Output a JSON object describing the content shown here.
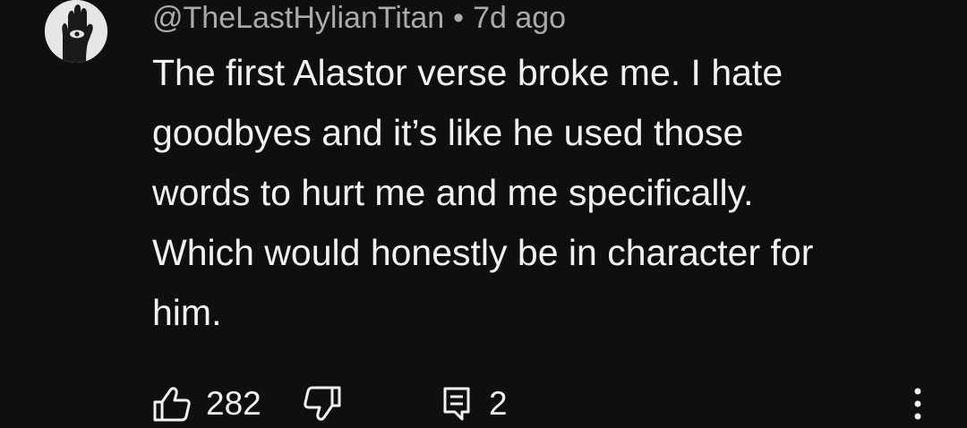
{
  "comment": {
    "author": "@TheLastHylianTitan",
    "separator": "•",
    "time_ago": "7d ago",
    "lines": [
      "The first Alastor verse broke me. I hate",
      "goodbyes and it’s like he used those",
      "words to hurt me and me specifically.",
      "Which would honestly be in character for",
      "him."
    ],
    "like_count": "282",
    "reply_count": "2"
  },
  "icons": {
    "avatar": "eye-in-hand-avatar",
    "like": "thumbs-up-icon",
    "dislike": "thumbs-down-icon",
    "reply": "reply-comment-icon",
    "more": "more-vertical-icon"
  },
  "colors": {
    "background": "#0f0f0f",
    "text": "#f1f1f1",
    "meta": "#aaaaaa"
  }
}
